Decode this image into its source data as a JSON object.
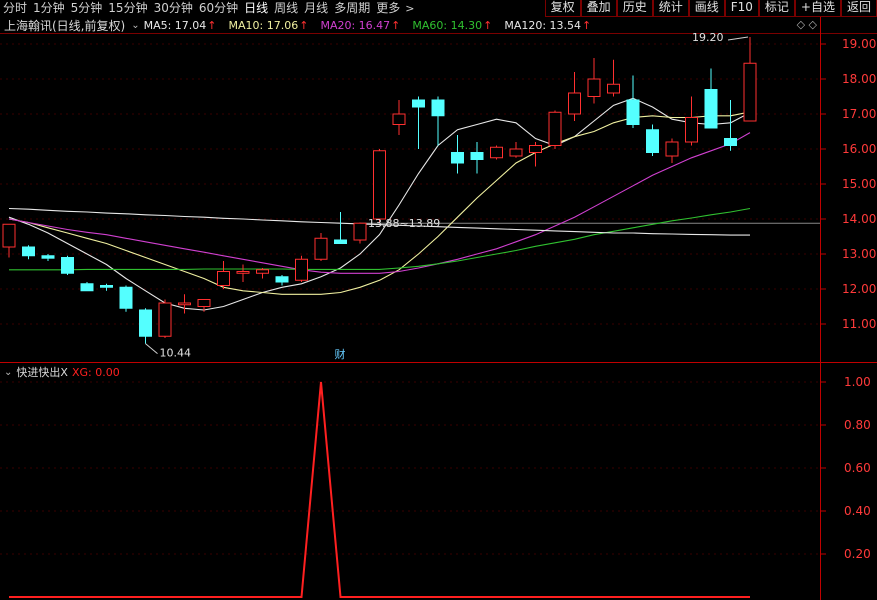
{
  "toolbar": {
    "period_tabs": [
      "分时",
      "1分钟",
      "5分钟",
      "15分钟",
      "30分钟",
      "60分钟",
      "日线",
      "周线",
      "月线",
      "多周期",
      "更多"
    ],
    "more_arrow": ">",
    "tools": [
      "复权",
      "叠加",
      "历史",
      "统计",
      "画线",
      "F10",
      "标记",
      "+自选",
      "返回"
    ]
  },
  "info": {
    "stock_name": "上海翰讯(日线,前复权)",
    "ma": [
      {
        "label": "MA5: 17.04",
        "color": "#e8e8e8"
      },
      {
        "label": "MA10: 17.06",
        "color": "#f0f0a0"
      },
      {
        "label": "MA20: 16.47",
        "color": "#d040d0"
      },
      {
        "label": "MA60: 14.30",
        "color": "#30c030"
      },
      {
        "label": "MA120: 13.54",
        "color": "#e8e8e8"
      }
    ],
    "up_arrow": "↑",
    "right_icons": "◇ ◇"
  },
  "sub": {
    "title": "快进快出X",
    "xg_label": "XG: 0.00"
  },
  "chart_data": [
    {
      "type": "candlestick",
      "ylim": [
        10.4,
        19.35
      ],
      "yticks": [
        "19.00",
        "18.00",
        "17.00",
        "16.00",
        "15.00",
        "14.00",
        "13.00",
        "12.00",
        "11.00"
      ],
      "ytick_values": [
        19,
        18,
        17,
        16,
        15,
        14,
        13,
        12,
        11
      ],
      "candles": [
        {
          "o": 13.2,
          "h": 13.3,
          "l": 12.9,
          "c": 13.85
        },
        {
          "o": 13.2,
          "h": 13.25,
          "l": 12.85,
          "c": 12.95
        },
        {
          "o": 12.95,
          "h": 13.0,
          "l": 12.8,
          "c": 12.88
        },
        {
          "o": 12.9,
          "h": 12.95,
          "l": 12.4,
          "c": 12.45
        },
        {
          "o": 12.15,
          "h": 12.2,
          "l": 12.0,
          "c": 11.95
        },
        {
          "o": 12.1,
          "h": 12.15,
          "l": 11.95,
          "c": 12.05
        },
        {
          "o": 12.05,
          "h": 12.1,
          "l": 11.35,
          "c": 11.45
        },
        {
          "o": 11.4,
          "h": 11.45,
          "l": 10.44,
          "c": 10.65
        },
        {
          "o": 10.65,
          "h": 11.7,
          "l": 10.6,
          "c": 11.6
        },
        {
          "o": 11.55,
          "h": 11.85,
          "l": 11.3,
          "c": 11.6
        },
        {
          "o": 11.5,
          "h": 11.7,
          "l": 11.35,
          "c": 11.7
        },
        {
          "o": 12.1,
          "h": 12.8,
          "l": 12.0,
          "c": 12.5
        },
        {
          "o": 12.45,
          "h": 12.7,
          "l": 12.2,
          "c": 12.5
        },
        {
          "o": 12.45,
          "h": 12.6,
          "l": 12.3,
          "c": 12.55
        },
        {
          "o": 12.35,
          "h": 12.4,
          "l": 12.1,
          "c": 12.2
        },
        {
          "o": 12.25,
          "h": 12.95,
          "l": 12.2,
          "c": 12.85
        },
        {
          "o": 12.85,
          "h": 13.6,
          "l": 12.8,
          "c": 13.45
        },
        {
          "o": 13.4,
          "h": 14.2,
          "l": 13.3,
          "c": 13.3
        },
        {
          "o": 13.4,
          "h": 13.9,
          "l": 13.3,
          "c": 13.88
        },
        {
          "o": 14.0,
          "h": 16.0,
          "l": 13.9,
          "c": 15.95
        },
        {
          "o": 16.7,
          "h": 17.4,
          "l": 16.4,
          "c": 17.0
        },
        {
          "o": 17.4,
          "h": 17.5,
          "l": 16.0,
          "c": 17.2
        },
        {
          "o": 17.4,
          "h": 17.5,
          "l": 16.1,
          "c": 16.95
        },
        {
          "o": 15.9,
          "h": 16.4,
          "l": 15.3,
          "c": 15.6
        },
        {
          "o": 15.9,
          "h": 16.2,
          "l": 15.3,
          "c": 15.7
        },
        {
          "o": 15.75,
          "h": 16.1,
          "l": 15.7,
          "c": 16.05
        },
        {
          "o": 15.8,
          "h": 16.2,
          "l": 15.75,
          "c": 16.0
        },
        {
          "o": 15.9,
          "h": 16.2,
          "l": 15.5,
          "c": 16.1
        },
        {
          "o": 16.1,
          "h": 17.1,
          "l": 16.0,
          "c": 17.05
        },
        {
          "o": 17.0,
          "h": 18.2,
          "l": 16.8,
          "c": 17.6
        },
        {
          "o": 17.5,
          "h": 18.6,
          "l": 17.3,
          "c": 18.0
        },
        {
          "o": 17.6,
          "h": 18.55,
          "l": 17.5,
          "c": 17.85
        },
        {
          "o": 17.4,
          "h": 18.1,
          "l": 16.6,
          "c": 16.7
        },
        {
          "o": 16.55,
          "h": 16.7,
          "l": 15.8,
          "c": 15.9
        },
        {
          "o": 15.8,
          "h": 16.3,
          "l": 15.6,
          "c": 16.2
        },
        {
          "o": 16.2,
          "h": 17.5,
          "l": 16.1,
          "c": 16.9
        },
        {
          "o": 17.7,
          "h": 18.3,
          "l": 16.6,
          "c": 16.6
        },
        {
          "o": 16.3,
          "h": 17.4,
          "l": 15.95,
          "c": 16.1
        },
        {
          "o": 16.8,
          "h": 19.2,
          "l": 16.8,
          "c": 18.45
        }
      ],
      "series": [
        {
          "name": "MA5",
          "color": "#e8e8e8",
          "values": [
            14.05,
            13.85,
            13.6,
            13.3,
            13.0,
            12.7,
            12.3,
            11.95,
            11.6,
            11.45,
            11.4,
            11.5,
            11.7,
            11.9,
            12.05,
            12.15,
            12.35,
            12.6,
            13.0,
            13.55,
            14.4,
            15.3,
            16.1,
            16.55,
            16.7,
            16.85,
            16.75,
            16.3,
            16.1,
            16.35,
            16.8,
            17.25,
            17.45,
            17.2,
            16.85,
            16.75,
            16.7,
            16.75,
            17.04
          ]
        },
        {
          "name": "MA10",
          "color": "#f0f0a0",
          "values": [
            14.0,
            13.9,
            13.75,
            13.6,
            13.45,
            13.3,
            13.1,
            12.9,
            12.7,
            12.5,
            12.3,
            12.05,
            11.95,
            11.9,
            11.85,
            11.85,
            11.85,
            11.9,
            12.05,
            12.25,
            12.55,
            13.0,
            13.5,
            14.05,
            14.6,
            15.1,
            15.6,
            15.9,
            16.15,
            16.35,
            16.5,
            16.75,
            16.9,
            16.95,
            16.9,
            16.9,
            16.95,
            16.95,
            17.06
          ]
        },
        {
          "name": "MA20",
          "color": "#d040d0",
          "values": [
            14.0,
            13.9,
            13.8,
            13.7,
            13.62,
            13.55,
            13.45,
            13.35,
            13.25,
            13.15,
            13.05,
            12.95,
            12.85,
            12.75,
            12.65,
            12.55,
            12.48,
            12.45,
            12.45,
            12.45,
            12.5,
            12.6,
            12.72,
            12.85,
            13.0,
            13.15,
            13.35,
            13.55,
            13.8,
            14.05,
            14.35,
            14.65,
            14.95,
            15.25,
            15.5,
            15.75,
            15.95,
            16.15,
            16.47
          ]
        },
        {
          "name": "MA60",
          "color": "#30c030",
          "values": [
            12.55,
            12.55,
            12.55,
            12.55,
            12.56,
            12.56,
            12.56,
            12.56,
            12.56,
            12.56,
            12.57,
            12.57,
            12.57,
            12.57,
            12.57,
            12.56,
            12.56,
            12.56,
            12.56,
            12.56,
            12.6,
            12.65,
            12.72,
            12.8,
            12.9,
            13.0,
            13.1,
            13.22,
            13.32,
            13.42,
            13.55,
            13.65,
            13.75,
            13.85,
            13.95,
            14.03,
            14.12,
            14.2,
            14.3
          ]
        },
        {
          "name": "MA120",
          "color": "#e8e8e8",
          "values": [
            14.3,
            14.28,
            14.25,
            14.22,
            14.2,
            14.17,
            14.15,
            14.12,
            14.1,
            14.07,
            14.05,
            14.02,
            14.0,
            13.97,
            13.95,
            13.92,
            13.9,
            13.88,
            13.86,
            13.84,
            13.82,
            13.8,
            13.78,
            13.76,
            13.74,
            13.72,
            13.7,
            13.68,
            13.66,
            13.64,
            13.62,
            13.6,
            13.6,
            13.58,
            13.57,
            13.56,
            13.55,
            13.54,
            13.54
          ]
        }
      ],
      "annotations": [
        {
          "text": "10.44",
          "candle": 7,
          "value": 10.44
        },
        {
          "text": "19.20",
          "candle": 38,
          "value": 19.2
        },
        {
          "text": "13.88~13.89",
          "candle": 18,
          "value": 13.88
        }
      ],
      "finance_marker": "财",
      "finance_candle": 17,
      "hline": 13.88
    },
    {
      "type": "line",
      "title": "快进快出X",
      "ylim": [
        0,
        1.08
      ],
      "yticks": [
        "1.00",
        "0.80",
        "0.60",
        "0.40",
        "0.20"
      ],
      "ytick_values": [
        1.0,
        0.8,
        0.6,
        0.4,
        0.2
      ],
      "series": [
        {
          "name": "XG",
          "color": "#ff2020",
          "values": [
            0,
            0,
            0,
            0,
            0,
            0,
            0,
            0,
            0,
            0,
            0,
            0,
            0,
            0,
            0,
            0,
            1,
            0,
            0,
            0,
            0,
            0,
            0,
            0,
            0,
            0,
            0,
            0,
            0,
            0,
            0,
            0,
            0,
            0,
            0,
            0,
            0,
            0,
            0
          ]
        }
      ]
    }
  ]
}
